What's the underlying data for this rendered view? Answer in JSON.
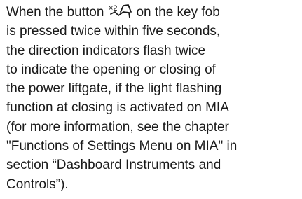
{
  "document": {
    "line1_before_icon": "When the button",
    "icon": "liftgate-twice-press-icon",
    "icon_label": "×2",
    "line1_after_icon": "on the key fob",
    "lines": [
      "is pressed twice within five seconds,",
      "the direction indicators flash twice",
      "to indicate the opening or closing of",
      "the power liftgate, if the light flashing",
      "function at closing is activated on MIA",
      "(for more information, see the chapter",
      "\"Functions of Settings Menu on MIA\" in",
      "section “Dashboard Instruments and",
      "Controls”)."
    ]
  }
}
